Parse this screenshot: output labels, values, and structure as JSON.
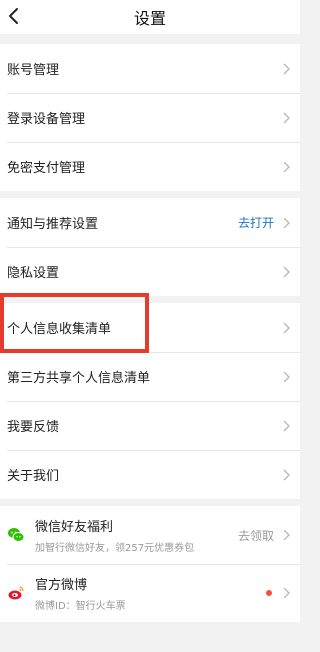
{
  "header": {
    "title": "设置"
  },
  "groups": [
    {
      "items": [
        {
          "label": "账号管理"
        },
        {
          "label": "登录设备管理"
        },
        {
          "label": "免密支付管理"
        }
      ]
    },
    {
      "items": [
        {
          "label": "通知与推荐设置",
          "value": "去打开"
        },
        {
          "label": "隐私设置"
        }
      ]
    },
    {
      "items": [
        {
          "label": "个人信息收集清单"
        },
        {
          "label": "第三方共享个人信息清单"
        },
        {
          "label": "我要反馈"
        },
        {
          "label": "关于我们"
        }
      ]
    }
  ],
  "social": [
    {
      "title": "微信好友福利",
      "subtitle": "加智行微信好友，领257元优惠券包",
      "action": "去领取",
      "icon": "wechat-icon"
    },
    {
      "title": "官方微博",
      "subtitle": "微博ID：智行火车票",
      "icon": "weibo-icon",
      "badge_color": "#ff4b3a"
    }
  ],
  "colors": {
    "link": "#1e73be",
    "highlight": "#e53b2f"
  }
}
